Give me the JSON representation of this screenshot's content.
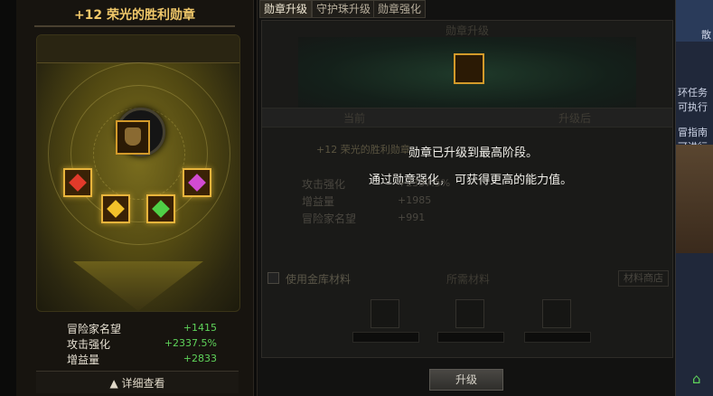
{
  "medal_panel": {
    "title": "+12 荣光的胜利勋章",
    "stats": [
      {
        "label": "冒险家名望",
        "value": "+1415"
      },
      {
        "label": "攻击强化",
        "value": "+2337.5%"
      },
      {
        "label": "增益量",
        "value": "+2833"
      }
    ],
    "detail_toggle": "▲ 详细查看"
  },
  "tabs": [
    {
      "label": "勋章升级"
    },
    {
      "label": "守护珠升级"
    },
    {
      "label": "勋章强化"
    }
  ],
  "upgrade": {
    "heading": "勋章升级",
    "col_current": "当前",
    "col_after": "升级后",
    "current_medal_name": "+12 荣光的胜利勋章",
    "message_line1": "勋章已升级到最高阶段。",
    "message_line2": "通过勋章强化，  可获得更高的能力值。",
    "stats": [
      {
        "label": "攻击强化",
        "value": "+2337.5%"
      },
      {
        "label": "增益量",
        "value": "+1985"
      },
      {
        "label": "冒险家名望",
        "value": "+991"
      }
    ],
    "use_vault_label": "使用金库材料",
    "materials_heading": "所需材料",
    "shop_button": "材料商店",
    "upgrade_button": "升级"
  },
  "right_edge": {
    "texts": [
      "散",
      "环任务",
      "可执行",
      "冒指南",
      "可进行"
    ]
  }
}
